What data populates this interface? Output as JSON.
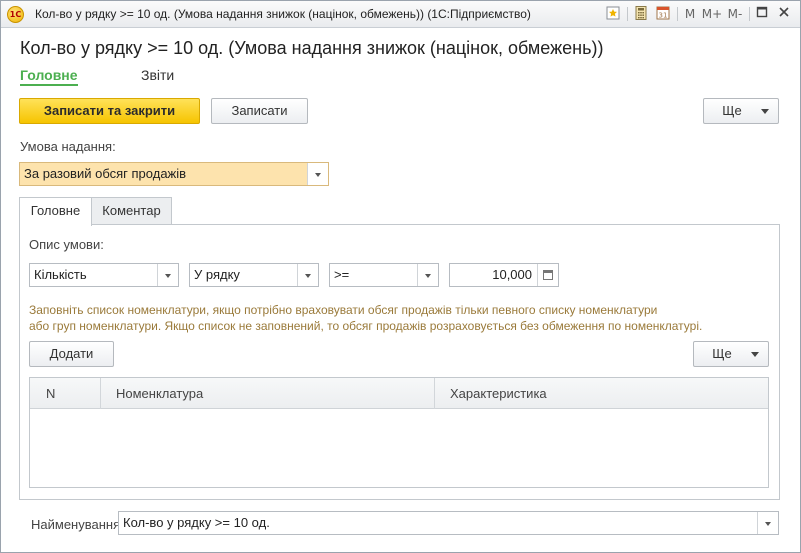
{
  "window": {
    "title": "Кол-во у рядку >= 10 од. (Умова надання знижок (націнок, обмежень))  (1С:Підприємство)",
    "logo_text": "1С",
    "toolbar": {
      "m": "M",
      "m_plus": "M+",
      "m_minus": "M-"
    }
  },
  "form": {
    "title": "Кол-во у рядку >= 10 од. (Умова надання знижок (націнок, обмежень))",
    "nav": {
      "main": "Головне",
      "reports": "Звіти"
    },
    "buttons": {
      "save_close": "Записати та закрити",
      "save": "Записати",
      "more": "Ще"
    },
    "condition_label": "Умова надання:",
    "condition_value": "За разовий обсяг продажів",
    "tabs": [
      {
        "label": "Головне",
        "active": true
      },
      {
        "label": "Коментар",
        "active": false
      }
    ],
    "description_label": "Опис умови:",
    "criteria": {
      "field1": "Кількість",
      "field2": "У рядку",
      "operator": ">=",
      "value": "10,000"
    },
    "hint_line1": "Заповніть список номенклатури, якщо потрібно враховувати обсяг продажів тільки певного списку номенклатури",
    "hint_line2": "або груп номенклатури. Якщо список не заповнений, то обсяг продажів розраховується без обмеження по номенклатурі.",
    "add_button": "Додати",
    "more_button": "Ще",
    "table": {
      "columns": [
        "N",
        "Номенклатура",
        "Характеристика"
      ],
      "rows": []
    },
    "name_label": "Найменування:",
    "name_value": "Кол-во у рядку >= 10 од."
  },
  "colors": {
    "accent_green": "#4caf50",
    "primary_button": "#f6c400",
    "highlight_field": "#fde3ad",
    "hint_text": "#9a7a3a"
  }
}
